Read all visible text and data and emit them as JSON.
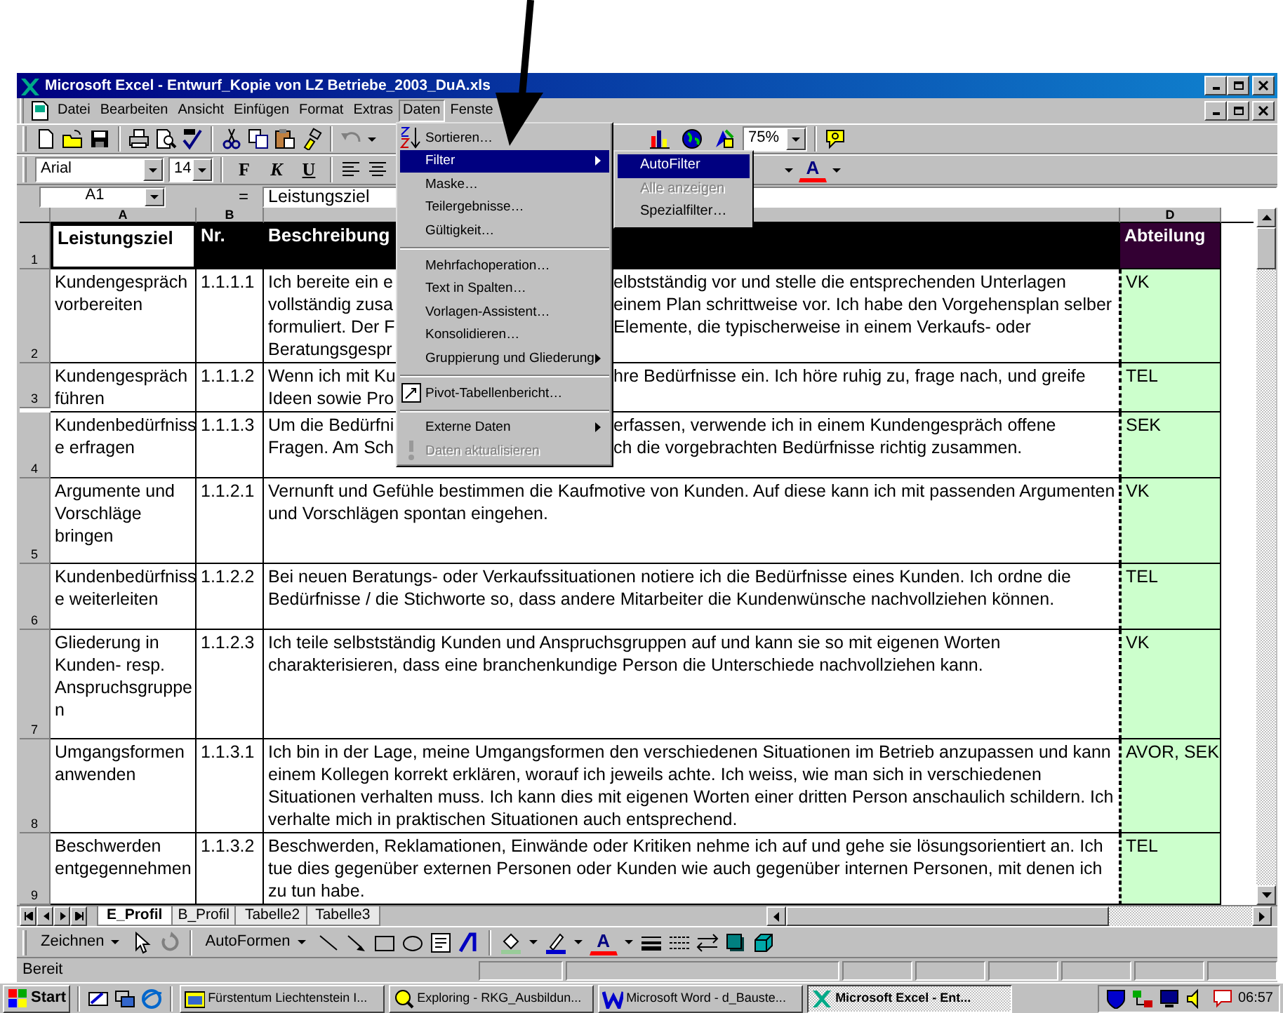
{
  "window": {
    "title": "Microsoft Excel - Entwurf_Kopie von LZ Betriebe_2003_DuA.xls"
  },
  "menu": [
    {
      "label": "Datei",
      "selected": false
    },
    {
      "label": "Bearbeiten",
      "selected": false
    },
    {
      "label": "Ansicht",
      "selected": false
    },
    {
      "label": "Einfügen",
      "selected": false
    },
    {
      "label": "Format",
      "selected": false
    },
    {
      "label": "Extras",
      "selected": false
    },
    {
      "label": "Daten",
      "selected": true
    },
    {
      "label": "Fenste",
      "selected": false
    }
  ],
  "standard_toolbar": {
    "zoom": "75%"
  },
  "formatting_toolbar": {
    "font": "Arial",
    "size": "14",
    "style_buttons": [
      "F",
      "K",
      "U"
    ],
    "font_color": "A"
  },
  "formula_bar": {
    "cell": "A1",
    "equals": "=",
    "value": "Leistungsziel"
  },
  "columns": [
    {
      "label": "A"
    },
    {
      "label": "B"
    },
    {},
    {
      "label": "D"
    }
  ],
  "header_row": {
    "number": "1",
    "cells": [
      "Leistungsziel",
      "Nr.",
      "Beschreibung",
      "Abteilung"
    ]
  },
  "rows": [
    {
      "number": "2",
      "goal": [
        "Kundengespräch",
        "vorbereiten"
      ],
      "nr": "1.1.1.1",
      "description_left": [
        "Ich bereite ein e",
        "vollständig zusa",
        "formuliert. Der F",
        "Beratungsgespr"
      ],
      "description_right": [
        "elbstständig vor und stelle die entsprechenden Unterlagen",
        "einem Plan schrittweise vor. Ich habe den Vorgehensplan selber",
        "Elemente, die typischerweise in einem Verkaufs- oder"
      ],
      "department": "VK"
    },
    {
      "number": "3",
      "goal": [
        "Kundengespräch",
        "führen"
      ],
      "nr": "1.1.1.2",
      "description_left": [
        "Wenn ich mit Ku",
        "Ideen sowie Pro"
      ],
      "description_right": [
        "hre Bedürfnisse ein. Ich höre ruhig zu, frage nach, und greife"
      ],
      "department": "TEL"
    },
    {
      "number": "4",
      "goal": [
        "Kundenbedürfniss",
        "e erfragen"
      ],
      "nr": "1.1.1.3",
      "description_left": [
        "Um die Bedürfni",
        "Fragen. Am Sch"
      ],
      "description_right": [
        "erfassen, verwende ich in einem Kundengespräch offene",
        "ch die vorgebrachten Bedürfnisse richtig zusammen."
      ],
      "department": "SEK"
    },
    {
      "number": "5",
      "goal": [
        "Argumente und",
        "Vorschläge",
        "bringen"
      ],
      "nr": "1.1.2.1",
      "description": [
        "Vernunft und Gefühle bestimmen die Kaufmotive von Kunden. Auf diese kann ich mit passenden Argumenten",
        "und Vorschlägen spontan eingehen."
      ],
      "department": "VK"
    },
    {
      "number": "6",
      "goal": [
        "Kundenbedürfniss",
        "e weiterleiten"
      ],
      "nr": "1.1.2.2",
      "description": [
        "Bei neuen Beratungs- oder Verkaufssituationen notiere ich die Bedürfnisse eines Kunden. Ich ordne die",
        "Bedürfnisse / die Stichworte so, dass andere Mitarbeiter die Kundenwünsche nachvollziehen können."
      ],
      "department": "TEL"
    },
    {
      "number": "7",
      "goal": [
        "Gliederung in",
        "Kunden- resp.",
        "Anspruchsgruppe",
        "n"
      ],
      "nr": "1.1.2.3",
      "description": [
        "Ich teile selbstständig Kunden und Anspruchsgruppen auf und kann sie so mit eigenen Worten",
        "charakterisieren, dass eine branchenkundige Person die Unterschiede nachvollziehen kann."
      ],
      "department": "VK"
    },
    {
      "number": "8",
      "goal": [
        "Umgangsformen",
        "anwenden"
      ],
      "nr": "1.1.3.1",
      "description": [
        "Ich bin in der Lage, meine Umgangsformen den verschiedenen Situationen im Betrieb anzupassen und kann",
        "einem Kollegen korrekt erklären, worauf ich jeweils achte. Ich weiss, wie man sich in verschiedenen",
        "Situationen verhalten muss. Ich kann dies mit eigenen Worten einer dritten Person anschaulich schildern. Ich",
        "verhalte mich in praktischen Situationen auch entsprechend."
      ],
      "department": "AVOR, SEK"
    },
    {
      "number": "9",
      "goal": [
        "Beschwerden",
        "entgegennehmen"
      ],
      "nr": "1.1.3.2",
      "description": [
        "Beschwerden, Reklamationen, Einwände oder Kritiken nehme ich auf und gehe sie lösungsorientiert an. Ich",
        "tue dies gegenüber externen Personen  oder Kunden wie auch gegenüber internen Personen, mit denen ich",
        "zu tun habe."
      ],
      "department": "TEL"
    }
  ],
  "data_menu": [
    {
      "label": "Sortieren…",
      "kind": "item",
      "selected": false,
      "disabled": false
    },
    {
      "label": "Filter",
      "kind": "submenu",
      "selected": true,
      "disabled": false
    },
    {
      "label": "Maske…",
      "kind": "item",
      "selected": false,
      "disabled": false
    },
    {
      "label": "Teilergebnisse…",
      "kind": "item",
      "selected": false,
      "disabled": false
    },
    {
      "label": "Gültigkeit…",
      "kind": "item",
      "selected": false,
      "disabled": false
    },
    {
      "kind": "separator"
    },
    {
      "label": "Mehrfachoperation…",
      "kind": "item",
      "selected": false,
      "disabled": false
    },
    {
      "label": "Text in Spalten…",
      "kind": "item",
      "selected": false,
      "disabled": false
    },
    {
      "label": "Vorlagen-Assistent…",
      "kind": "item",
      "selected": false,
      "disabled": false
    },
    {
      "label": "Konsolidieren…",
      "kind": "item",
      "selected": false,
      "disabled": false
    },
    {
      "label": "Gruppierung und Gliederung",
      "kind": "submenu",
      "selected": false,
      "disabled": false
    },
    {
      "kind": "separator"
    },
    {
      "label": "Pivot-Tabellenbericht…",
      "kind": "item",
      "selected": false,
      "disabled": false
    },
    {
      "kind": "separator"
    },
    {
      "label": "Externe Daten",
      "kind": "submenu",
      "selected": false,
      "disabled": false
    },
    {
      "label": "Daten aktualisieren",
      "kind": "item",
      "selected": false,
      "disabled": true
    }
  ],
  "filter_submenu": [
    {
      "label": "AutoFilter",
      "selected": true,
      "disabled": false
    },
    {
      "label": "Alle anzeigen",
      "selected": false,
      "disabled": true
    },
    {
      "label": "Spezialfilter…",
      "selected": false,
      "disabled": false
    }
  ],
  "sheet_tabs": [
    {
      "label": "E_Profil",
      "selected": true
    },
    {
      "label": "B_Profil",
      "selected": false
    },
    {
      "label": "Tabelle2",
      "selected": false
    },
    {
      "label": "Tabelle3",
      "selected": false
    }
  ],
  "drawing_toolbar": {
    "draw": "Zeichnen",
    "autoshapes": "AutoFormen",
    "font_color": "A"
  },
  "status_bar": "Bereit",
  "taskbar": {
    "start": "Start",
    "tasks": [
      {
        "label": "Fürstentum Liechtenstein I...",
        "selected": false
      },
      {
        "label": "Exploring - RKG_Ausbildun...",
        "selected": false
      },
      {
        "label": "Microsoft Word - d_Bauste...",
        "selected": false
      },
      {
        "label": "Microsoft Excel - Ent...",
        "selected": true
      }
    ],
    "clock": "06:57"
  }
}
